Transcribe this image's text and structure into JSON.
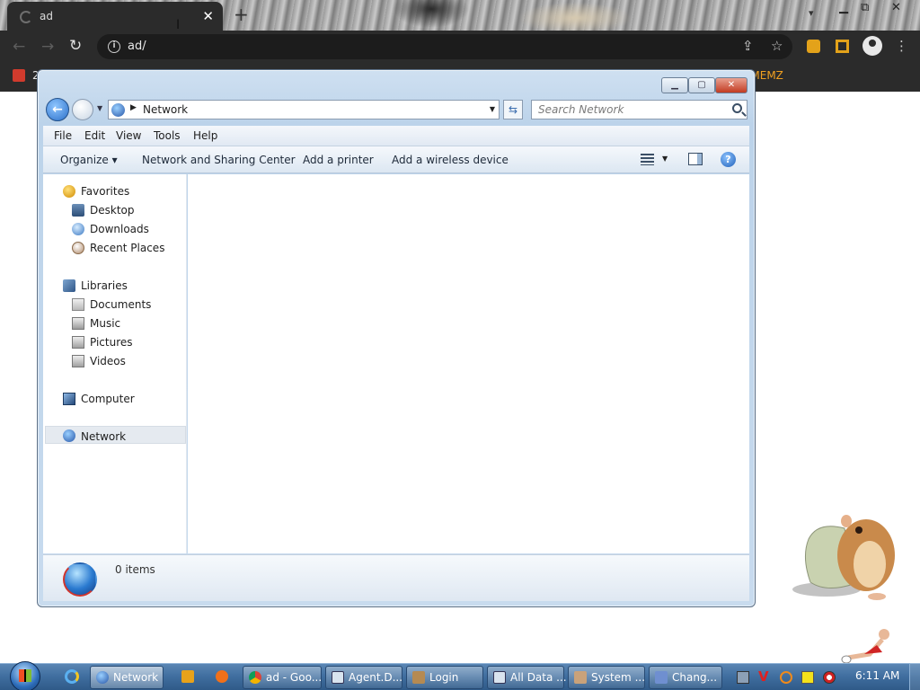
{
  "browser": {
    "tab_title": "ad",
    "tab_close": "✕",
    "new_tab": "+",
    "url": "ad/",
    "bookmark_left": "2",
    "bookmark_right": "eMEMZ"
  },
  "explorer": {
    "address": "Network",
    "search_placeholder": "Search Network",
    "menu": [
      "File",
      "Edit",
      "View",
      "Tools",
      "Help"
    ],
    "commands": {
      "organize": "Organize ▾",
      "sharing": "Network and Sharing Center",
      "printer": "Add a printer",
      "wireless": "Add a wireless device"
    },
    "nav": {
      "favorites": "Favorites",
      "desktop": "Desktop",
      "downloads": "Downloads",
      "recent": "Recent Places",
      "libraries": "Libraries",
      "documents": "Documents",
      "music": "Music",
      "pictures": "Pictures",
      "videos": "Videos",
      "computer": "Computer",
      "network": "Network"
    },
    "details": "0 items"
  },
  "taskbar": {
    "tasks": [
      "Network",
      "ad - Goo...",
      "Agent.D...",
      "Login",
      "All Data ...",
      "System ...",
      "Chang..."
    ],
    "clock": "6:11 AM"
  },
  "colors": {
    "accent": "#2a6fc9",
    "taskbar": "#3f6d9e",
    "bookmark_accent": "#f0a020"
  }
}
